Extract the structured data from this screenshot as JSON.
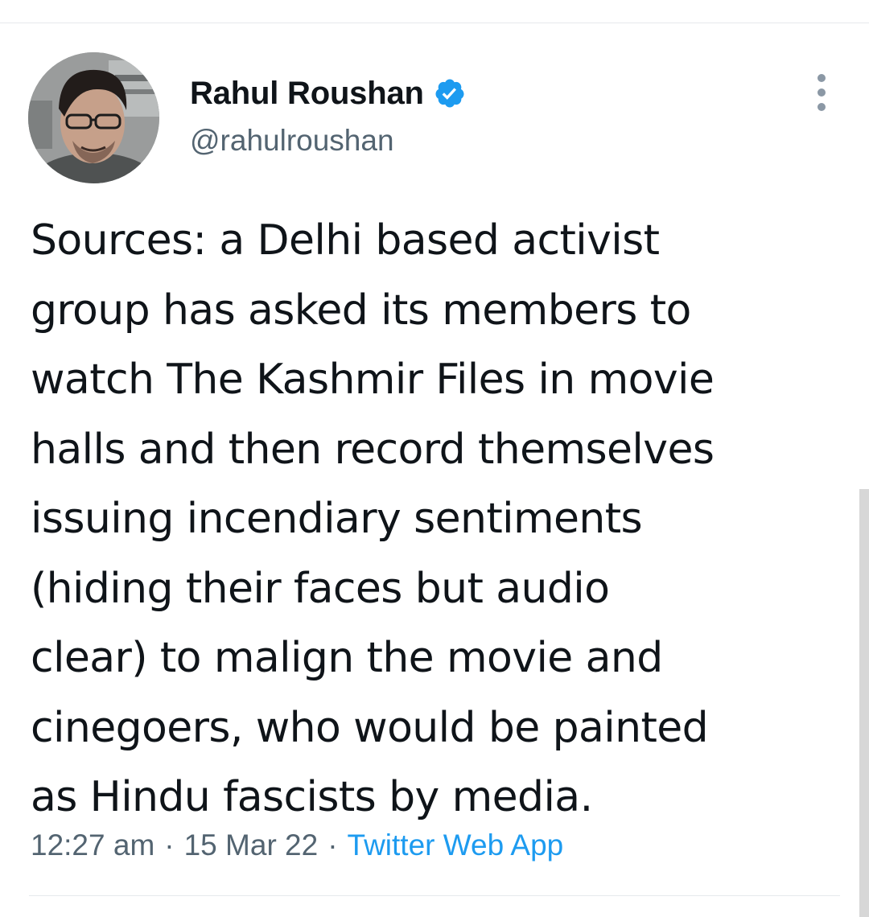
{
  "user": {
    "display_name": "Rahul Roushan",
    "handle": "@rahulroushan",
    "verified": true
  },
  "icons": {
    "verified": "verified-badge-icon",
    "more": "more-options-icon",
    "avatar": "user-avatar"
  },
  "tweet": {
    "text": "Sources: a Delhi based activist\ngroup has asked its members to\nwatch The Kashmir Files in movie\nhalls and then record themselves\nissuing incendiary sentiments\n(hiding their faces but audio\nclear) to malign the movie and\ncinegoers, who would be painted\nas Hindu fascists by media.",
    "time": "12:27 am",
    "date": "15 Mar 22",
    "source": "Twitter Web App",
    "separator": "·"
  },
  "colors": {
    "text": "#0f1419",
    "secondary": "#536471",
    "accent": "#1d9bf0",
    "divider": "#e6e9ec"
  }
}
